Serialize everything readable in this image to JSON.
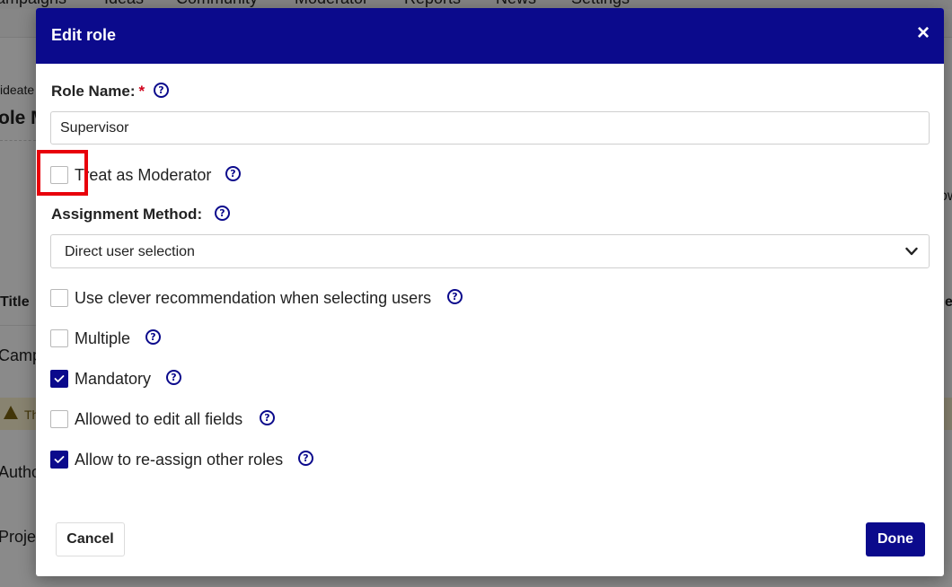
{
  "background": {
    "nav_items": [
      "ampaigns",
      "Ideas",
      "Community",
      "Moderator",
      "Reports",
      "News",
      "Settings"
    ],
    "breadcrumb": "ideate",
    "page_title": "ole M",
    "column_title": "Title",
    "row_1": "Camp",
    "warning_text": "Th",
    "row_2": "Autho",
    "row_3": "Proje",
    "right_fragment_1": "ow",
    "right_fragment_2": "e"
  },
  "modal": {
    "title": "Edit role",
    "close_symbol": "×",
    "role_name": {
      "label": "Role Name:",
      "required_mark": "*",
      "value": "Supervisor",
      "placeholder": ""
    },
    "treat_as_moderator": {
      "label": "Treat as Moderator",
      "checked": false
    },
    "assignment_method": {
      "label": "Assignment Method:",
      "selected": "Direct user selection"
    },
    "options": [
      {
        "label": "Use clever recommendation when selecting users",
        "checked": false
      },
      {
        "label": "Multiple",
        "checked": false
      },
      {
        "label": "Mandatory",
        "checked": true
      },
      {
        "label": "Allowed to edit all fields",
        "checked": false
      },
      {
        "label": "Allow to re-assign other roles",
        "checked": true
      }
    ],
    "help_symbol": "?",
    "cancel_label": "Cancel",
    "done_label": "Done"
  },
  "colors": {
    "header_bg": "#0b0a8c",
    "accent": "#0b0a8c",
    "required": "#d0021b",
    "highlight": "#e8000b"
  }
}
